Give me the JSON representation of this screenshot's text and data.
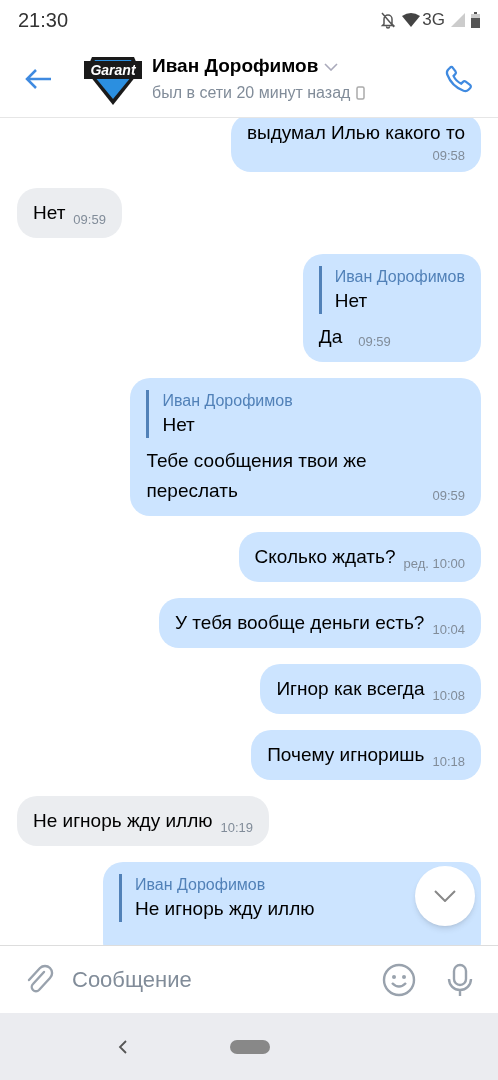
{
  "status_bar": {
    "time": "21:30",
    "network": "3G"
  },
  "header": {
    "avatar_text": "Garant",
    "name": "Иван Дорофимов",
    "status": "был в сети 20 минут назад"
  },
  "messages": [
    {
      "kind": "multiline",
      "outgoing": true,
      "text": "выдумал Илью какого то",
      "time": "09:58"
    },
    {
      "kind": "text",
      "outgoing": false,
      "text": "Нет",
      "time": "09:59"
    },
    {
      "kind": "reply",
      "outgoing": true,
      "quote_author": "Иван Дорофимов",
      "quote_text": "Нет",
      "text": "Да",
      "time": "09:59"
    },
    {
      "kind": "reply",
      "outgoing": true,
      "quote_author": "Иван Дорофимов",
      "quote_text": "Нет",
      "text": "Тебе сообщения твои же переслать",
      "time": "09:59"
    },
    {
      "kind": "text",
      "outgoing": true,
      "text": "Сколько ждать?",
      "time": "ред. 10:00"
    },
    {
      "kind": "text",
      "outgoing": true,
      "text": "У тебя вообще деньги есть?",
      "time": "10:04"
    },
    {
      "kind": "text",
      "outgoing": true,
      "text": "Игнор как всегда",
      "time": "10:08"
    },
    {
      "kind": "text",
      "outgoing": true,
      "text": "Почему игноришь",
      "time": "10:18"
    },
    {
      "kind": "text",
      "outgoing": false,
      "text": "Не игнорь жду иллю",
      "time": "10:19"
    },
    {
      "kind": "reply",
      "outgoing": true,
      "quote_author": "Иван Дорофимов",
      "quote_text": "Не игнорь жду иллю"
    }
  ],
  "composer": {
    "placeholder": "Сообщение"
  }
}
